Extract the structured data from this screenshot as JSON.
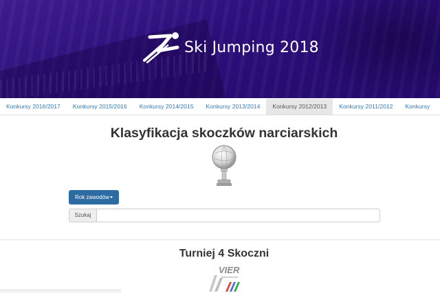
{
  "header": {
    "title": "Ski Jumping 2018",
    "logo_icon": "ski-jumper-logo-icon"
  },
  "tabs": [
    {
      "label": "Konkursy 2016/2017",
      "active": false
    },
    {
      "label": "Konkursy 2015/2016",
      "active": false
    },
    {
      "label": "Konkursy 2014/2015",
      "active": false
    },
    {
      "label": "Konkursy 2013/2014",
      "active": false
    },
    {
      "label": "Konkursy 2012/2013",
      "active": true
    },
    {
      "label": "Konkursy 2011/2012",
      "active": false
    },
    {
      "label": "Konkursy",
      "active": false
    }
  ],
  "main": {
    "title": "Klasyfikacja skoczków narciarskich",
    "trophy_icon": "crystal-globe-trophy-icon",
    "year_dropdown": {
      "label": "Rok zawodów"
    },
    "search": {
      "label": "Szukaj",
      "value": "",
      "placeholder": ""
    }
  },
  "section": {
    "title": "Turniej 4 Skoczni",
    "logo_text": "VIER"
  },
  "colors": {
    "header_bg": "#2c0e7a",
    "link": "#337ab7",
    "button": "#2d6ca2",
    "active_tab_bg": "#e7e7e7"
  }
}
